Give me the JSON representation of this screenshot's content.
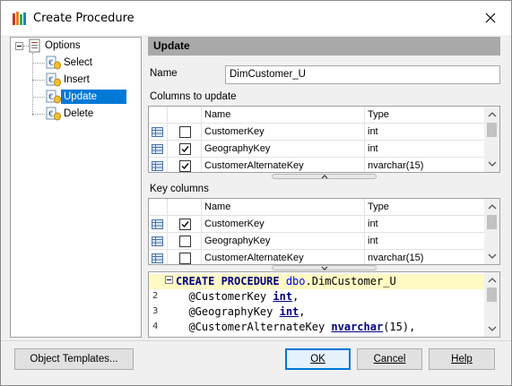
{
  "window": {
    "title": "Create Procedure"
  },
  "tree": {
    "root": "Options",
    "items": [
      {
        "label": "Select",
        "selected": false
      },
      {
        "label": "Insert",
        "selected": false
      },
      {
        "label": "Update",
        "selected": true
      },
      {
        "label": "Delete",
        "selected": false
      }
    ]
  },
  "panel": {
    "header": "Update",
    "name_label": "Name",
    "name_value": "DimCustomer_U",
    "columns_label": "Columns to update",
    "key_columns_label": "Key columns"
  },
  "columns_grid": {
    "headers": {
      "name": "Name",
      "type": "Type"
    },
    "rows": [
      {
        "name": "CustomerKey",
        "type": "int",
        "checked": false
      },
      {
        "name": "GeographyKey",
        "type": "int",
        "checked": true
      },
      {
        "name": "CustomerAlternateKey",
        "type": "nvarchar(15)",
        "checked": true
      }
    ]
  },
  "key_grid": {
    "headers": {
      "name": "Name",
      "type": "Type"
    },
    "rows": [
      {
        "name": "CustomerKey",
        "type": "int",
        "checked": true
      },
      {
        "name": "GeographyKey",
        "type": "int",
        "checked": false
      },
      {
        "name": "CustomerAlternateKey",
        "type": "nvarchar(15)",
        "checked": false
      }
    ]
  },
  "code": {
    "lines": [
      {
        "n": "",
        "parts": [
          [
            "kw",
            "CREATE PROCEDURE "
          ],
          [
            "obj",
            "dbo"
          ],
          [
            "",
            "."
          ],
          [
            "",
            "DimCustomer_U"
          ]
        ]
      },
      {
        "n": "2",
        "parts": [
          [
            "",
            "  @CustomerKey "
          ],
          [
            "typ",
            "int"
          ],
          [
            "",
            ","
          ]
        ]
      },
      {
        "n": "3",
        "parts": [
          [
            "",
            "  @GeographyKey "
          ],
          [
            "typ",
            "int"
          ],
          [
            "",
            ","
          ]
        ]
      },
      {
        "n": "4",
        "parts": [
          [
            "",
            "  @CustomerAlternateKey "
          ],
          [
            "typ",
            "nvarchar"
          ],
          [
            "",
            "("
          ],
          [
            "num",
            "15"
          ],
          [
            "",
            "),"
          ]
        ]
      }
    ]
  },
  "buttons": {
    "templates": "Object Templates...",
    "ok": "OK",
    "cancel": "Cancel",
    "help": "Help"
  },
  "colors": {
    "selection": "#0078d7",
    "header_bar": "#a9a9a9",
    "current_line": "#fff9c4"
  }
}
